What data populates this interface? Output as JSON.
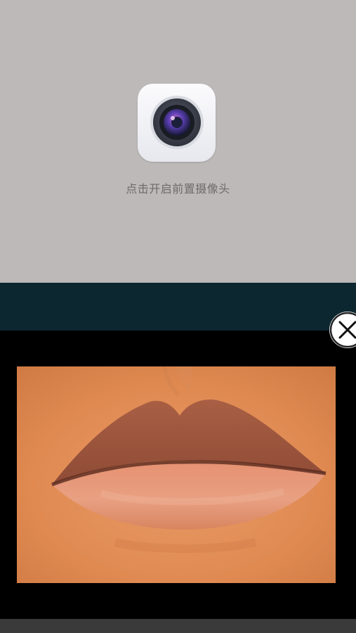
{
  "camera": {
    "icon": "camera-icon",
    "label": "点击开启前置摄像头"
  },
  "popup": {
    "image_subject": "lips",
    "close_icon": "close-icon"
  },
  "colors": {
    "camera_background": "#bcb9b8",
    "teal_bar": "#0d2730",
    "popup_background": "#000000",
    "label_text": "#6e6b6a"
  }
}
